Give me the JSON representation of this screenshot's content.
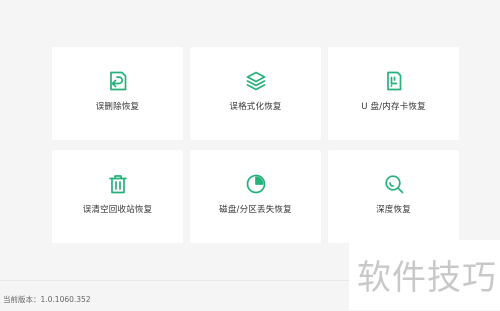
{
  "accent_color": "#27b17a",
  "cards": [
    {
      "label": "误删除恢复",
      "icon": "deleted-file-recovery-icon"
    },
    {
      "label": "误格式化恢复",
      "icon": "layers-icon"
    },
    {
      "label": "U 盘/内存卡恢复",
      "icon": "memory-card-icon"
    },
    {
      "label": "误清空回收站恢复",
      "icon": "trash-bin-icon"
    },
    {
      "label": "磁盘/分区丢失恢复",
      "icon": "disk-partition-icon"
    },
    {
      "label": "深度恢复",
      "icon": "deep-scan-icon"
    }
  ],
  "footer": {
    "version": "当前版本：1.0.1060.352"
  },
  "watermark": "软件技巧"
}
